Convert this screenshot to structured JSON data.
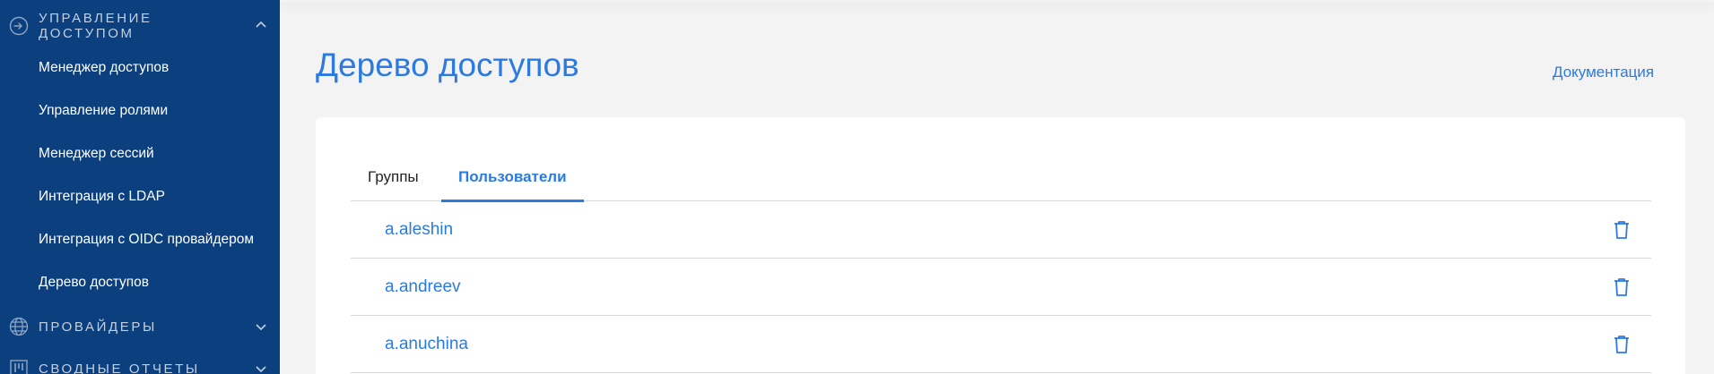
{
  "sidebar": {
    "sections": [
      {
        "label_line1": "Управление",
        "label_line2": "доступом",
        "icon": "sign-in-icon",
        "expanded": true
      },
      {
        "label": "Провайдеры",
        "icon": "globe-icon",
        "expanded": false
      },
      {
        "label": "Сводные отчеты",
        "icon": "kanban-icon",
        "expanded": false
      }
    ],
    "items": [
      {
        "label": "Менеджер доступов"
      },
      {
        "label": "Управление ролями"
      },
      {
        "label": "Менеджер сессий"
      },
      {
        "label": "Интеграция с LDAP"
      },
      {
        "label": "Интеграция с OIDC провайдером"
      },
      {
        "label": "Дерево доступов"
      }
    ]
  },
  "main": {
    "title": "Дерево доступов",
    "doc_link": "Документация",
    "tabs": [
      {
        "label": "Группы",
        "active": false
      },
      {
        "label": "Пользователи",
        "active": true
      }
    ],
    "users": [
      {
        "name": "a.aleshin"
      },
      {
        "name": "a.andreev"
      },
      {
        "name": "a.anuchina"
      }
    ]
  },
  "colors": {
    "sidebar_bg": "#0b3f7e",
    "accent": "#2a7ae2",
    "page_bg": "#f3f3f3"
  }
}
